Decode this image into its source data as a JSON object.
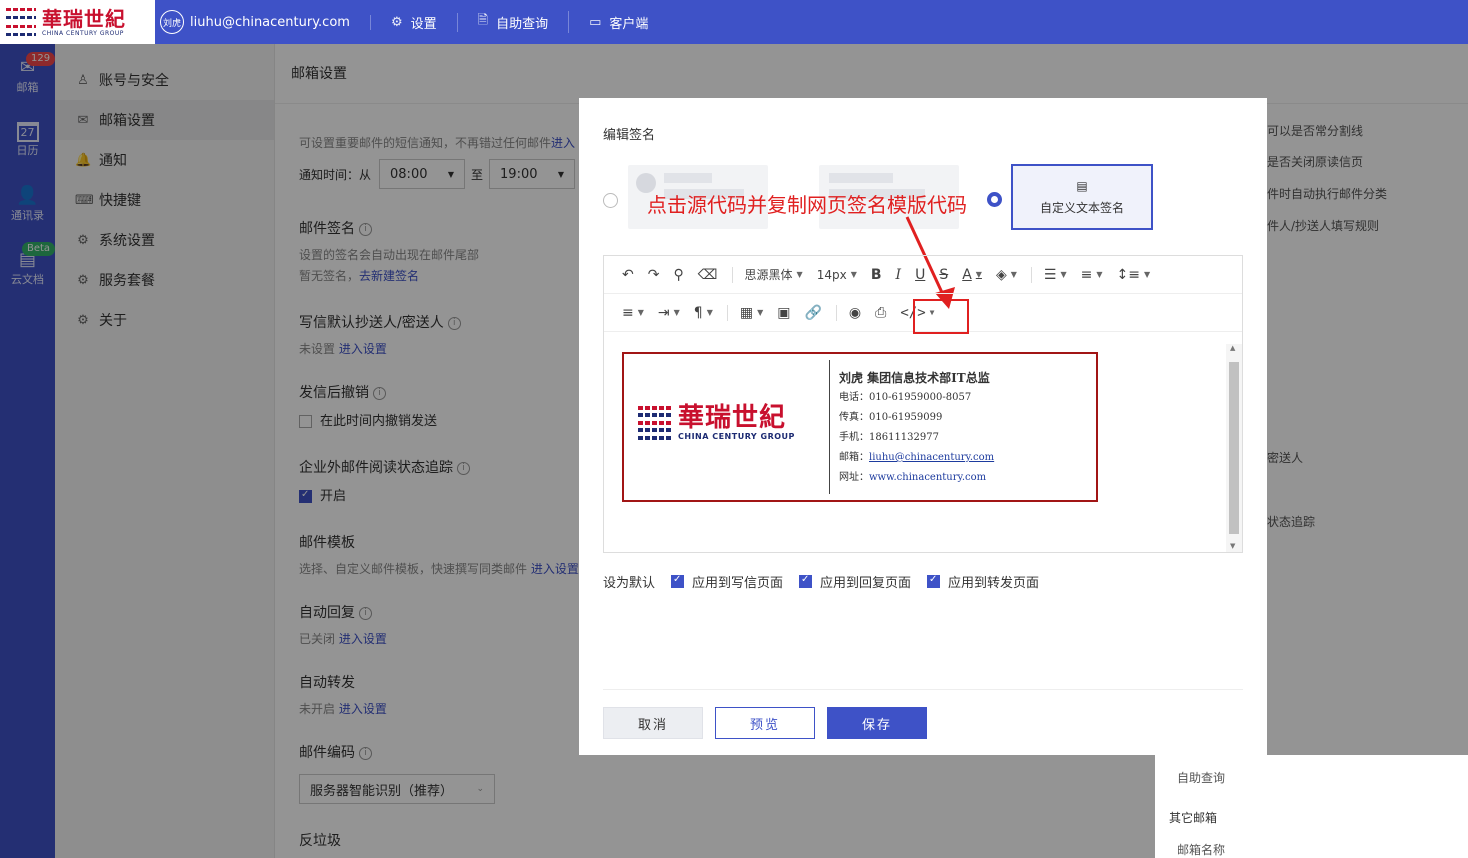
{
  "topbar": {
    "logo_cn": "華瑞世紀",
    "logo_en": "CHINA CENTURY GROUP",
    "avatar": "刘虎",
    "email": "liuhu@chinacentury.com",
    "links": [
      "设置",
      "自助查询",
      "客户端"
    ]
  },
  "leftnav": {
    "items": [
      {
        "label": "邮箱",
        "icon": "mail-icon",
        "badge": "129"
      },
      {
        "label": "日历",
        "icon": "calendar-icon",
        "badge": ""
      },
      {
        "label": "通讯录",
        "icon": "contacts-icon",
        "badge": ""
      },
      {
        "label": "云文档",
        "icon": "cloud-doc-icon",
        "badge": "Beta"
      }
    ],
    "calendar_day": "27"
  },
  "menu": {
    "items": [
      "账号与安全",
      "邮箱设置",
      "通知",
      "快捷键",
      "系统设置",
      "服务套餐",
      "关于"
    ]
  },
  "main": {
    "title": "邮箱设置",
    "sms_desc": "可设置重要邮件的短信通知，不再错过任何邮件",
    "sms_link": "进入",
    "notify_label": "通知时间：从",
    "from_time": "08:00",
    "to_label": "至",
    "to_time": "19:00",
    "signature_title": "邮件签名",
    "signature_desc": "设置的签名会自动出现在邮件尾部",
    "signature_none": "暂无签名，",
    "signature_link": "去新建签名",
    "cc_title": "写信默认抄送人/密送人",
    "cc_status": "未设置",
    "enter_settings": "进入设置",
    "undo_title": "发信后撤销",
    "undo_option": "在此时间内撤销发送",
    "track_title": "企业外邮件阅读状态追踪",
    "track_option": "开启",
    "template_title": "邮件模板",
    "template_desc": "选择、自定义邮件模板，快速撰写同类邮件",
    "autoreply_title": "自动回复",
    "autoreply_status": "已关闭",
    "forward_title": "自动转发",
    "forward_status": "未开启",
    "encoding_title": "邮件编码",
    "encoding_value": "服务器智能识别（推荐）",
    "spam_title": "反垃圾"
  },
  "right_col": {
    "lines": [
      "可以是否常分割线",
      "是否关闭原读信页",
      "件时自动执行邮件分类",
      "件人/抄送人填写规则",
      "密送人",
      "状态追踪",
      "自助查询",
      "其它邮箱",
      "邮箱名称"
    ]
  },
  "dialog": {
    "title": "编辑签名",
    "annotation": "点击源代码并复制网页签名模版代码",
    "custom_label": "自定义文本签名",
    "toolbar": {
      "font": "思源黑体",
      "size": "14px"
    },
    "signature": {
      "name": "刘虎  集团信息技术部IT总监",
      "phone": "电话：010-61959000-8057",
      "fax": "传真：010-61959099",
      "mobile": "手机：18611132977",
      "email_label": "邮箱：",
      "email": "liuhu@chinacentury.com",
      "site_label": "网址：",
      "site": "www.chinacentury.com"
    },
    "defaults_label": "设为默认",
    "options": [
      "应用到写信页面",
      "应用到回复页面",
      "应用到转发页面"
    ],
    "buttons": {
      "cancel": "取消",
      "preview": "预览",
      "save": "保存"
    }
  },
  "colors": {
    "brand": "#3e52c7",
    "annotation": "#e02020",
    "logo_red": "#c8102e"
  }
}
